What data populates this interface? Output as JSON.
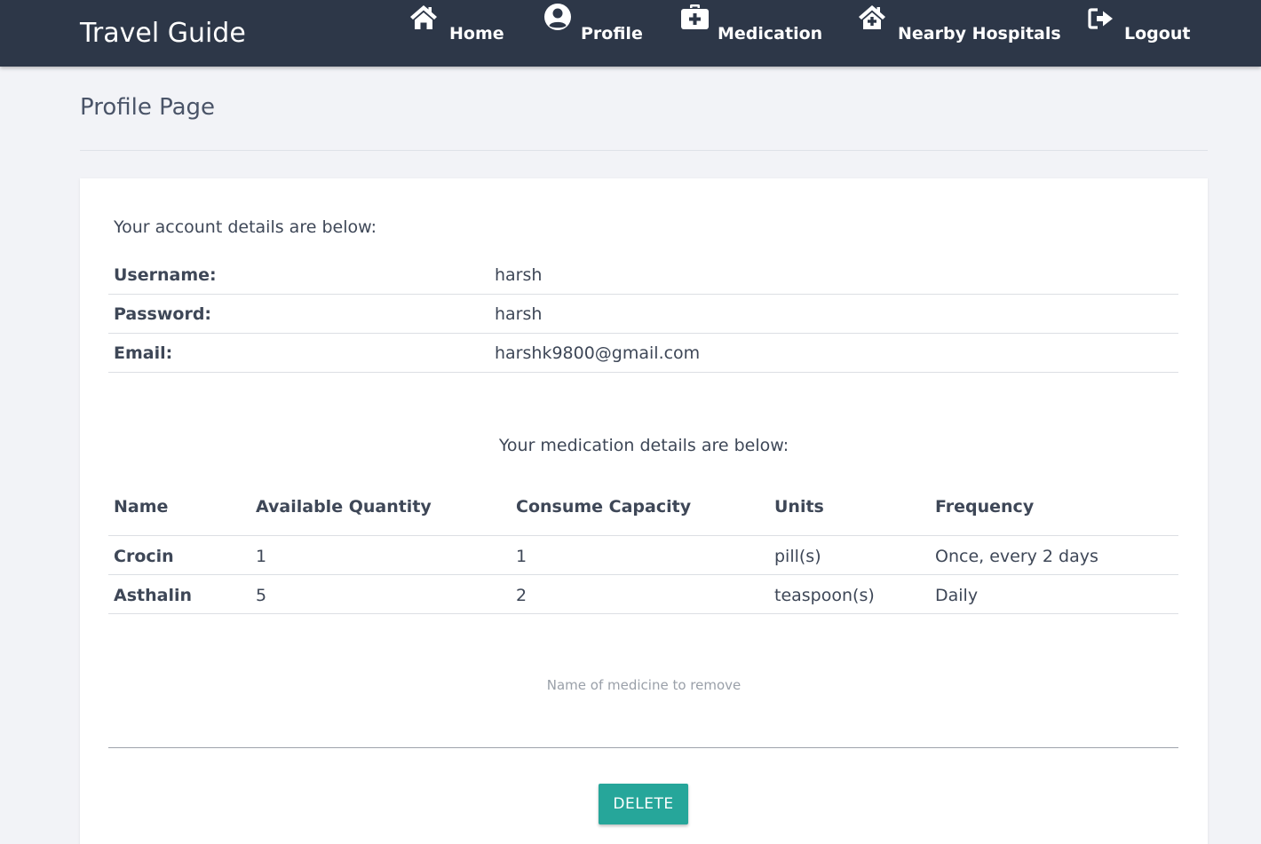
{
  "navbar": {
    "brand": "Travel Guide",
    "items": [
      {
        "label": "Home",
        "icon": "home-icon"
      },
      {
        "label": "Profile",
        "icon": "user-circle-icon"
      },
      {
        "label": "Medication",
        "icon": "medkit-icon"
      },
      {
        "label": "Nearby Hospitals",
        "icon": "clinic-icon"
      },
      {
        "label": "Logout",
        "icon": "sign-out-icon"
      }
    ]
  },
  "page": {
    "title": "Profile Page"
  },
  "account": {
    "intro": "Your account details are below:",
    "rows": [
      {
        "label": "Username:",
        "value": "harsh"
      },
      {
        "label": "Password:",
        "value": "harsh"
      },
      {
        "label": "Email:",
        "value": "harshk9800@gmail.com"
      }
    ]
  },
  "medication": {
    "intro": "Your medication details are below:",
    "headers": [
      "Name",
      "Available Quantity",
      "Consume Capacity",
      "Units",
      "Frequency"
    ],
    "rows": [
      [
        "Crocin",
        "1",
        "1",
        "pill(s)",
        "Once, every 2 days"
      ],
      [
        "Asthalin",
        "5",
        "2",
        "teaspoon(s)",
        "Daily"
      ]
    ]
  },
  "remove": {
    "placeholder": "Name of medicine to remove",
    "value": "",
    "button_label": "DELETE"
  },
  "colors": {
    "navbar_bg": "#2d3748",
    "page_bg": "#f2f3f7",
    "accent": "#26a69a"
  }
}
